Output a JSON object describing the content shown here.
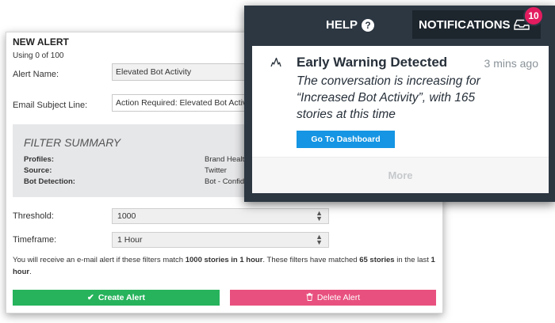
{
  "alert_form": {
    "title": "NEW ALERT",
    "usage": "Using 0 of 100",
    "name_label": "Alert Name:",
    "name_value": "Elevated Bot Activity",
    "subject_label": "Email Subject Line:",
    "subject_value": "Action Required: Elevated Bot Activity",
    "filter_summary": {
      "title": "FILTER SUMMARY",
      "rows": [
        {
          "key": "Profiles:",
          "value": "Brand Health"
        },
        {
          "key": "Source:",
          "value": "Twitter"
        },
        {
          "key": "Bot Detection:",
          "value": "Bot - Confidence"
        }
      ]
    },
    "threshold_label": "Threshold:",
    "threshold_value": "1000",
    "timeframe_label": "Timeframe:",
    "timeframe_value": "1 Hour",
    "note": {
      "part1": "You will receive an e-mail alert if these filters match ",
      "bold1": "1000 stories in 1 hour",
      "part2": ". These filters have matched ",
      "bold2": "65 stories",
      "part3": " in the last ",
      "bold3": "1 hour",
      "part4": "."
    },
    "create_label": "Create Alert",
    "delete_label": "Delete Alert"
  },
  "header": {
    "help_label": "HELP",
    "notifications_label": "NOTIFICATIONS",
    "badge_count": "10"
  },
  "notification": {
    "title": "Early Warning Detected",
    "time": "3 mins ago",
    "body": "The conversation is increasing for “Increased Bot Activity”, with 165 stories at this time",
    "button_label": "Go To Dashboard",
    "more_label": "More"
  },
  "colors": {
    "create": "#26b35c",
    "delete": "#e8517f",
    "badge": "#e31c5f",
    "dashboard_button": "#1595e3",
    "header_bg": "#2c3742"
  },
  "icons": {
    "help": "question-circle-icon",
    "notifications": "inbox-tray-icon",
    "alert": "spike-chart-icon",
    "create": "checkmark-icon",
    "delete": "trash-icon"
  }
}
